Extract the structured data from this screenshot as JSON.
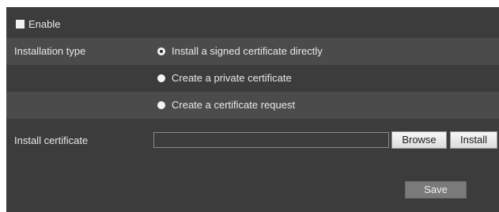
{
  "enable": {
    "label": "Enable",
    "checked": false
  },
  "installation_type": {
    "label": "Installation type",
    "options": [
      {
        "label": "Install a signed certificate directly",
        "selected": true
      },
      {
        "label": "Create a private certificate",
        "selected": false
      },
      {
        "label": "Create a certificate request",
        "selected": false
      }
    ]
  },
  "install_certificate": {
    "label": "Install certificate",
    "value": "",
    "browse_label": "Browse",
    "install_label": "Install"
  },
  "save_label": "Save",
  "colors": {
    "panel_bg": "#3c3c3c",
    "row_alt_bg": "#4b4b4b",
    "text": "#e8e8e8",
    "save_button_bg": "#7a7a7a"
  }
}
